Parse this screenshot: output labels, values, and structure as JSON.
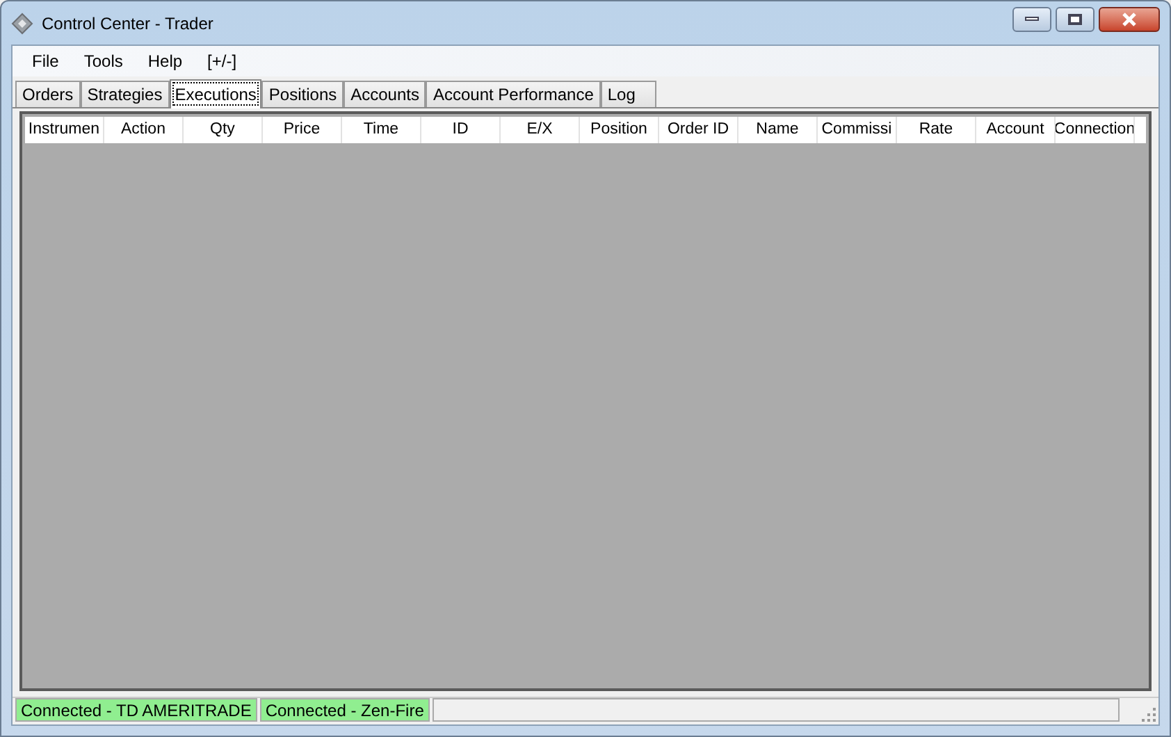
{
  "window": {
    "title": "Control Center - Trader"
  },
  "menu": [
    "File",
    "Tools",
    "Help",
    "[+/-]"
  ],
  "tabs": [
    {
      "label": "Orders",
      "selected": false
    },
    {
      "label": "Strategies",
      "selected": false
    },
    {
      "label": "Executions",
      "selected": true
    },
    {
      "label": "Positions",
      "selected": false
    },
    {
      "label": "Accounts",
      "selected": false
    },
    {
      "label": "Account Performance",
      "selected": false
    },
    {
      "label": "Log",
      "selected": false
    }
  ],
  "table": {
    "columns": [
      "Instrumen",
      "Action",
      "Qty",
      "Price",
      "Time",
      "ID",
      "E/X",
      "Position",
      "Order ID",
      "Name",
      "Commissi",
      "Rate",
      "Account",
      "Connection"
    ]
  },
  "status_bar": [
    {
      "text": "Connected - TD AMERITRADE",
      "color": "#90ee90"
    },
    {
      "text": "Connected - Zen-Fire",
      "color": "#90ee90"
    }
  ]
}
